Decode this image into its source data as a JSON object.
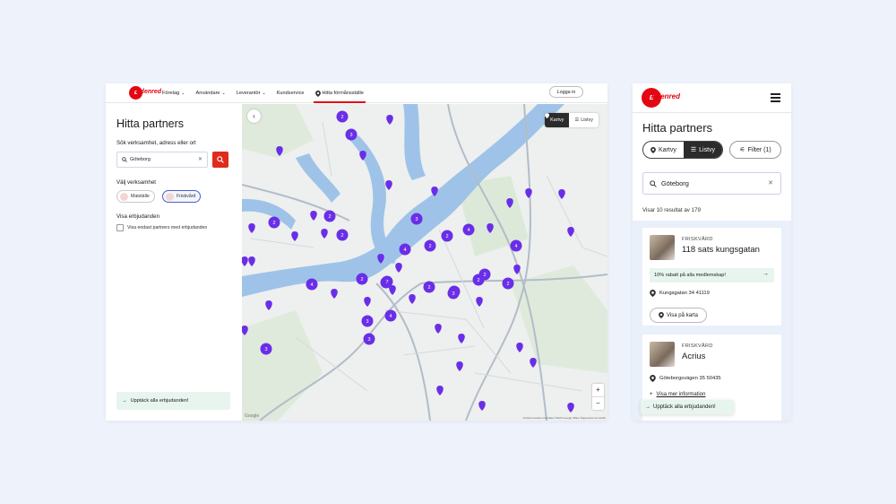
{
  "desktop": {
    "logo": "Edenred",
    "nav": [
      {
        "label": "Företag",
        "dropdown": true
      },
      {
        "label": "Användare",
        "dropdown": true
      },
      {
        "label": "Leverantör",
        "dropdown": true
      },
      {
        "label": "Kundservice",
        "dropdown": false
      },
      {
        "label": "Hitta förmånsställe",
        "dropdown": false,
        "active": true
      }
    ],
    "login_label": "Logga in",
    "sidebar": {
      "title": "Hitta partners",
      "search_label": "Sök verksamhet, adress eller ort",
      "search_value": "Göteborg",
      "business_label": "Välj verksamhet",
      "chips": [
        {
          "label": "Matställe",
          "selected": false
        },
        {
          "label": "Friskvård",
          "selected": true
        }
      ],
      "offers_label": "Visa erbjudanden",
      "offers_checkbox_label": "Visa endast partners med erbjudanden",
      "discover_label": "Upptäck alla erbjudanden!"
    },
    "map": {
      "view_map_label": "Kartvy",
      "view_list_label": "Listvy",
      "zoom_in": "+",
      "zoom_out": "−",
      "attribution": "Kortkommandon   Kartdata ©2023 Google   Villkor   Rapportera ett kartfel",
      "google": "Google",
      "marker_color": "#6a2ee8",
      "clusters": [
        "2",
        "3",
        "2",
        "2",
        "2",
        "3",
        "2",
        "4",
        "2",
        "4",
        "4",
        "2",
        "2",
        "2",
        "2",
        "2",
        "3",
        "4",
        "2",
        "7",
        "3",
        "4",
        "3",
        "3",
        "3"
      ]
    }
  },
  "mobile": {
    "logo": "Edenred",
    "title": "Hitta partners",
    "view_map_label": "Kartvy",
    "view_list_label": "Listvy",
    "filter_label": "Filter (1)",
    "search_value": "Göteborg",
    "result_count": "Visar 10 resultat av 179",
    "results": [
      {
        "category": "FRISKVÅRD",
        "name": "118 sats kungsgatan",
        "offer": "10% rabatt på alla medlemskap!",
        "address": "Kungsgatan 34 41119",
        "show_on_map": "Visa på karta"
      },
      {
        "category": "FRISKVÅRD",
        "name": "Acrius",
        "address": "Göteborgsvägen 35 50435",
        "more_info": "Visa mer information"
      }
    ],
    "discover_label": "Upptäck alla erbjudanden!"
  }
}
